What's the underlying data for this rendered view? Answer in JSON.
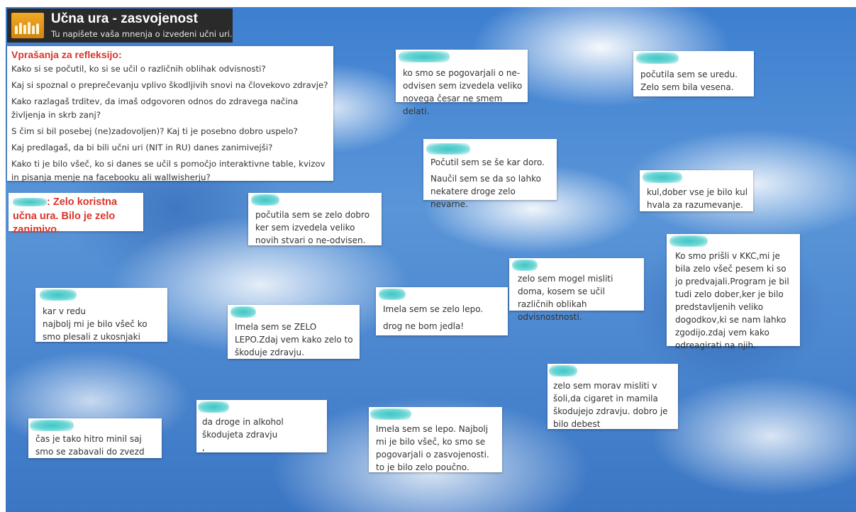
{
  "header": {
    "title": "Učna ura - zasvojenost",
    "subtitle": "Tu napišete vaša mnenja o izvedeni učni uri."
  },
  "questions": {
    "heading": "Vprašanja za refleksijo:",
    "items": [
      "Kako si se počutil, ko si se učil o različnih oblihak odvisnosti?",
      "Kaj si spoznal o preprečevanju vplivo škodljivih snovi na človekovo zdravje?",
      "Kako razlagaš trditev, da imaš odgovoren odnos do zdravega načina življenja in skrb zanj?",
      "S čim si bil posebej (ne)zadovoljen)? Kaj ti je posebno dobro uspelo?",
      "Kaj predlagaš, da bi bili učni uri (NIT in RU) danes zanimivejši?",
      "Kako ti je bilo všeč, ko si danes se učil  s pomočjo interaktivne table, kvizov in pisanja menje na facebooku ali wallwisherju?"
    ]
  },
  "featured": {
    "text": ": Zelo koristna učna ura. Bilo je zelo zanimivo."
  },
  "notes": [
    {
      "lines": [
        "ko smo se pogovarjali o ne-odvisen sem izvedela veliko novega česar ne smem delati."
      ]
    },
    {
      "lines": [
        "počutila sem se uredu.",
        "Zelo sem bila vesena."
      ]
    },
    {
      "lines": [
        "Počutil sem se še kar doro.",
        "Naučil sem se da so lahko nekatere droge zelo nevarne."
      ]
    },
    {
      "lines": [
        "kul,dober vse je bilo kul hvala za razumevanje."
      ]
    },
    {
      "lines": [
        "počutila sem se zelo dobro ker sem izvedela veliko novih stvari o ne-odvisen."
      ]
    },
    {
      "lines": [
        "Ko smo prišli v KKC,mi je bila zelo všeč pesem ki so jo predvajali.Program je bil tudi zelo dober,ker je bilo predstavljenih veliko dogodkov,ki se nam lahko zgodijo.zdaj vem kako odreagirati na njih."
      ]
    },
    {
      "lines": [
        "zelo sem mogel misliti doma, kosem se učil različnih oblikah odvisnostnosti."
      ]
    },
    {
      "lines": [
        "kar v redu",
        "najbolj mi je bilo všeč ko smo plesali z ukosnjaki"
      ]
    },
    {
      "lines": [
        "Imela sem se zelo lepo.",
        "drog ne bom jedla!"
      ]
    },
    {
      "lines": [
        "Imela sem se ZELO LEPO.Zdaj vem kako zelo to škoduje zdravju."
      ]
    },
    {
      "lines": [
        "zelo sem morav misliti v šoli,da cigaret in mamila škodujejo zdravju. dobro je bilo debest"
      ]
    },
    {
      "lines": [
        "da droge in alkohol škodujeta zdravju",
        ","
      ]
    },
    {
      "lines": [
        "čas je tako hitro minil saj smo se zabavali do zvezd"
      ]
    },
    {
      "lines": [
        "Imela sem se lepo. Najbolj mi je bilo všeč, ko smo se pogovarjali o zasvojenosti. to je bilo zelo poučno."
      ]
    }
  ]
}
